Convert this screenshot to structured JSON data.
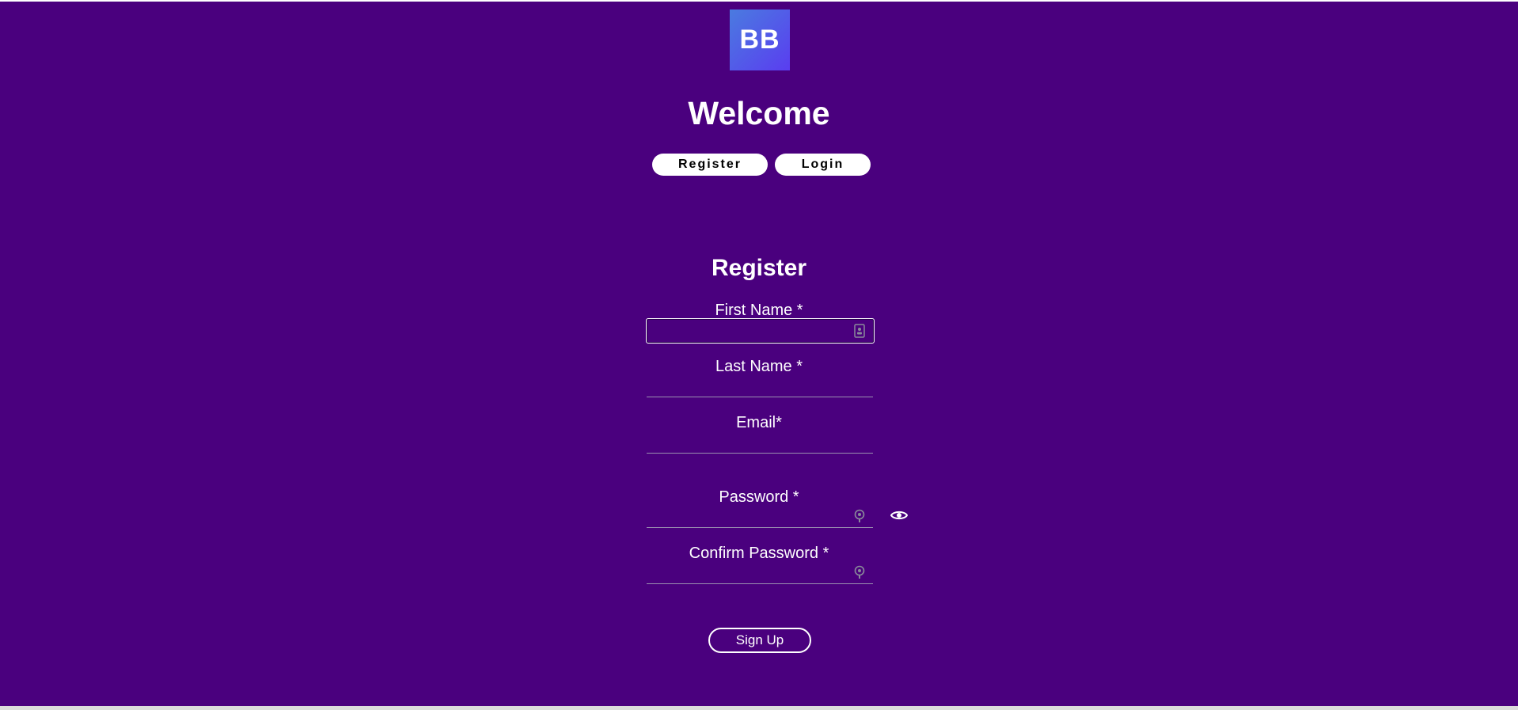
{
  "logo": {
    "text": "BB"
  },
  "header": {
    "title": "Welcome",
    "register_label": "Register",
    "login_label": "Login"
  },
  "form": {
    "title": "Register",
    "first_name_label": "First Name *",
    "first_name_value": "",
    "last_name_label": "Last Name *",
    "last_name_value": "",
    "email_label": "Email*",
    "email_value": "",
    "password_label": "Password *",
    "password_value": "",
    "confirm_password_label": "Confirm Password *",
    "confirm_password_value": "",
    "submit_label": "Sign Up"
  },
  "colors": {
    "background": "#4a007e",
    "text": "#ffffff",
    "logo_gradient_start": "#4a7be0",
    "logo_gradient_end": "#5a3df0"
  },
  "icons": {
    "first_name_field": "contact-card-icon",
    "password_field": "key-icon",
    "confirm_password_field": "key-icon",
    "password_toggle": "eye-icon"
  }
}
